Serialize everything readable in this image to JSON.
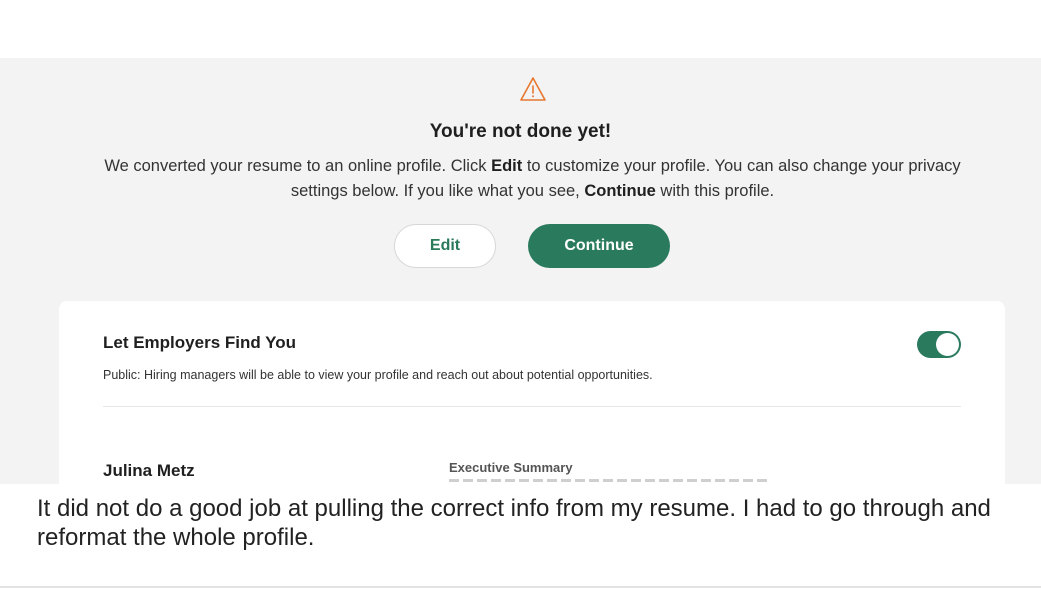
{
  "banner": {
    "icon": "warning-triangle-icon",
    "title": "You're not done yet!",
    "description_parts": [
      "We converted your resume to an online profile. Click ",
      "Edit",
      " to customize your profile. You can also change your privacy settings below. If you like what you see, ",
      "Continue",
      " with this profile."
    ]
  },
  "buttons": {
    "edit_label": "Edit",
    "continue_label": "Continue"
  },
  "visibility": {
    "title": "Let Employers Find You",
    "subtitle": "Public: Hiring managers will be able to view your profile and reach out about potential opportunities.",
    "toggle_on": true
  },
  "profile": {
    "name": "Julina Metz",
    "section_label": "Executive Summary"
  },
  "review": {
    "text": "It did not do a good job at pulling the correct info from my resume. I had to go through and reformat the whole profile."
  },
  "colors": {
    "accent": "#2a7a5e",
    "warning": "#e8772e",
    "panel_bg": "#f3f3f4"
  }
}
